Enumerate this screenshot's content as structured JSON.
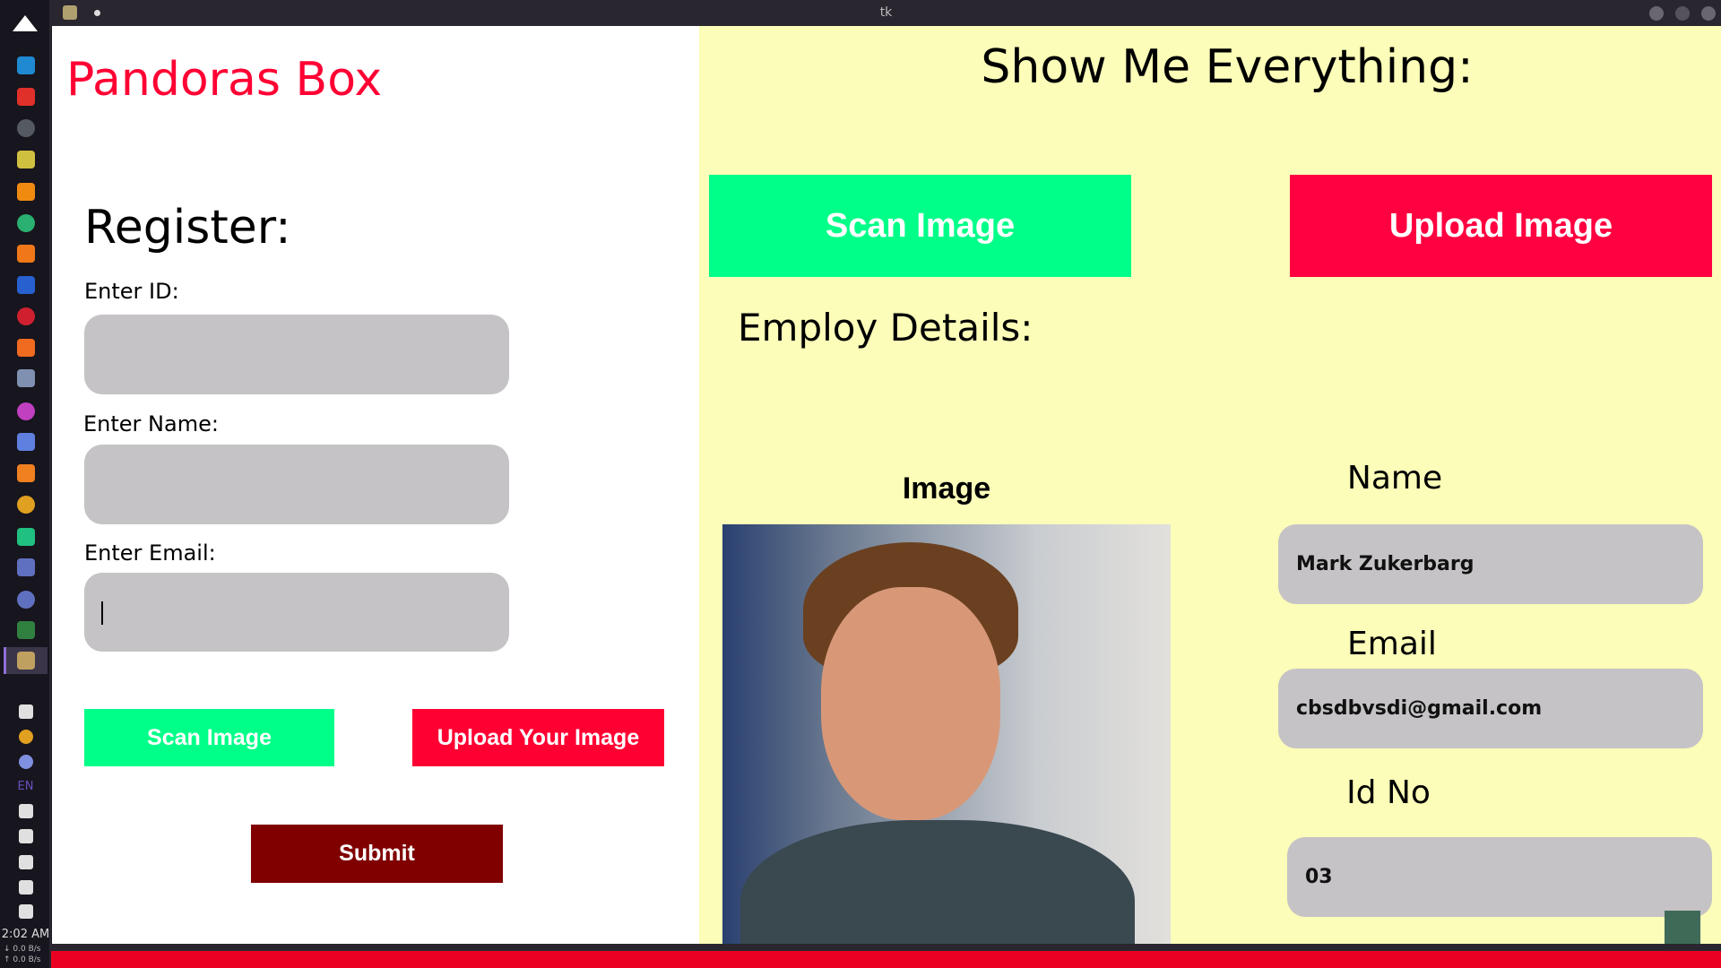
{
  "window": {
    "title": "tk"
  },
  "sidebar": {
    "icons": [
      {
        "name": "mountain-logo-icon",
        "color": "#ffffff"
      },
      {
        "name": "vscode-icon",
        "color": "#1f8ad2"
      },
      {
        "name": "color-grid-icon",
        "color": "#e0302a"
      },
      {
        "name": "terminal-icon",
        "color": "#555a60"
      },
      {
        "name": "tools-icon",
        "color": "#d0c040"
      },
      {
        "name": "vlc-icon",
        "color": "#f08a10"
      },
      {
        "name": "green-circle-icon",
        "color": "#2ab070"
      },
      {
        "name": "sublime-icon",
        "color": "#f07818"
      },
      {
        "name": "blue-circle-icon",
        "color": "#2860d0"
      },
      {
        "name": "red-app-icon",
        "color": "#d02030"
      },
      {
        "name": "firefox-icon",
        "color": "#f06a20"
      },
      {
        "name": "box-icon",
        "color": "#8090b0"
      },
      {
        "name": "github-icon",
        "color": "#c040c0"
      },
      {
        "name": "arrows-icon",
        "color": "#6080e0"
      },
      {
        "name": "layers-icon",
        "color": "#f08020"
      },
      {
        "name": "chrome-icon",
        "color": "#e0a020"
      },
      {
        "name": "pycharm-icon",
        "color": "#20c080"
      },
      {
        "name": "files-icon",
        "color": "#6070c0"
      },
      {
        "name": "files-2-icon",
        "color": "#6070c0"
      },
      {
        "name": "globe-icon",
        "color": "#308040"
      },
      {
        "name": "tk-app-icon",
        "color": "#c0a060"
      }
    ],
    "tray": [
      {
        "name": "bluetooth-icon",
        "color": "#e0e0e0"
      },
      {
        "name": "chrome-tray-icon",
        "color": "#e0a020"
      },
      {
        "name": "settings-gear-icon",
        "color": "#8090e0"
      },
      {
        "name": "wifi-icon",
        "color": "#e0e0e0"
      },
      {
        "name": "lock-icon",
        "color": "#e0e0e0"
      },
      {
        "name": "clipboard-icon",
        "color": "#e0e0e0"
      },
      {
        "name": "volume-icon",
        "color": "#e0e0e0"
      },
      {
        "name": "expand-arrow-icon",
        "color": "#e0e0e0"
      }
    ],
    "lang": "EN",
    "clock": "2:02 AM",
    "net_down": "↓ 0.0 B/s",
    "net_up": "↑ 0.0 B/s"
  },
  "left": {
    "app_title": "Pandoras Box",
    "register_heading": "Register:",
    "id_label": "Enter ID:",
    "id_value": "",
    "name_label": "Enter Name:",
    "name_value": "",
    "email_label": "Enter Email:",
    "email_value": "",
    "scan_button": "Scan Image",
    "upload_button": "Upload Your Image",
    "submit_button": "Submit"
  },
  "right": {
    "heading": "Show Me Everything:",
    "scan_button": "Scan Image",
    "upload_button": "Upload Image",
    "details_heading": "Employ Details:",
    "image_label": "Image",
    "name_label": "Name",
    "name_value": "Mark Zukerbarg",
    "email_label": "Email",
    "email_value": "cbsdbvsdi@gmail.com",
    "id_label": "Id No",
    "id_value": "03"
  },
  "colors": {
    "title_red": "#ff0033",
    "scan_green": "#00ff88",
    "upload_red": "#ff0040",
    "submit_maroon": "#800000",
    "right_bg": "#fbfdb8",
    "field_gray": "#c5c3c6"
  }
}
